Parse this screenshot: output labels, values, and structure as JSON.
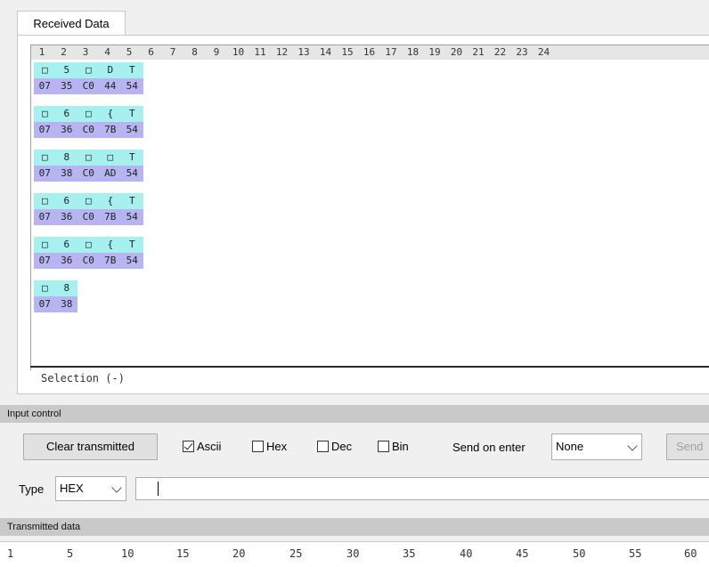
{
  "received": {
    "tab_label": "Received Data",
    "column_numbers": [
      "1",
      "2",
      "3",
      "4",
      "5",
      "6",
      "7",
      "8",
      "9",
      "10",
      "11",
      "12",
      "13",
      "14",
      "15",
      "16",
      "17",
      "18",
      "19",
      "20",
      "21",
      "22",
      "23",
      "24"
    ],
    "rows": [
      {
        "ascii": [
          "□",
          "5",
          "□",
          "D",
          "T"
        ],
        "hex": [
          "07",
          "35",
          "C0",
          "44",
          "54"
        ]
      },
      {
        "ascii": [
          "□",
          "6",
          "□",
          "{",
          "T"
        ],
        "hex": [
          "07",
          "36",
          "C0",
          "7B",
          "54"
        ]
      },
      {
        "ascii": [
          "□",
          "8",
          "□",
          "□",
          "T"
        ],
        "hex": [
          "07",
          "38",
          "C0",
          "AD",
          "54"
        ]
      },
      {
        "ascii": [
          "□",
          "6",
          "□",
          "{",
          "T"
        ],
        "hex": [
          "07",
          "36",
          "C0",
          "7B",
          "54"
        ]
      },
      {
        "ascii": [
          "□",
          "6",
          "□",
          "{",
          "T"
        ],
        "hex": [
          "07",
          "36",
          "C0",
          "7B",
          "54"
        ]
      },
      {
        "ascii": [
          "□",
          "8"
        ],
        "hex": [
          "07",
          "38"
        ]
      }
    ],
    "selection_label": "Selection (-)"
  },
  "input_control": {
    "header": "Input control",
    "clear_button": "Clear transmitted",
    "checkboxes": [
      {
        "label": "Ascii",
        "checked": true
      },
      {
        "label": "Hex",
        "checked": false
      },
      {
        "label": "Dec",
        "checked": false
      },
      {
        "label": "Bin",
        "checked": false
      }
    ],
    "send_on_enter_label": "Send on enter",
    "send_on_enter_value": "None",
    "send_button": "Send",
    "type_label": "Type",
    "type_value": "HEX",
    "input_value": ""
  },
  "transmitted": {
    "header": "Transmitted data",
    "ruler": [
      "1",
      "5",
      "10",
      "15",
      "20",
      "25",
      "30",
      "35",
      "40",
      "45",
      "50",
      "55",
      "60"
    ]
  },
  "colors": {
    "ascii_cell": "#a6f0f0",
    "hex_cell": "#b8b4f2",
    "section_header": "#c9c9c9"
  }
}
